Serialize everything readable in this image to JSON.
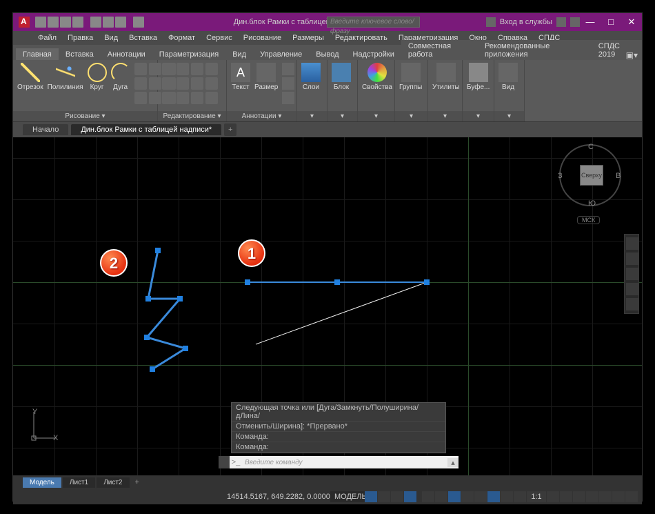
{
  "title": "Дин.блок Рамки с таблицей надписи...",
  "search_placeholder": "Введите ключевое слово/фразу",
  "login_label": "Вход в службы",
  "win": {
    "min": "—",
    "max": "□",
    "close": "✕"
  },
  "menu": [
    "Файл",
    "Правка",
    "Вид",
    "Вставка",
    "Формат",
    "Сервис",
    "Рисование",
    "Размеры",
    "Редактировать",
    "Параметризация",
    "Окно",
    "Справка",
    "СПДС"
  ],
  "tabs": [
    "Главная",
    "Вставка",
    "Аннотации",
    "Параметризация",
    "Вид",
    "Управление",
    "Вывод",
    "Надстройки",
    "Совместная работа",
    "Рекомендованные приложения",
    "СПДС 2019"
  ],
  "active_tab": 0,
  "ribbon": {
    "draw": {
      "title": "Рисование ▾",
      "items": [
        "Отрезок",
        "Полилиния",
        "Круг",
        "Дуга"
      ]
    },
    "edit": {
      "title": "Редактирование ▾"
    },
    "annot": {
      "title": "Аннотации ▾",
      "text": "Текст",
      "dim": "Размер"
    },
    "layers": "Слои",
    "block": "Блок",
    "props": "Свойства",
    "groups": "Группы",
    "utils": "Утилиты",
    "buffer": "Буфе...",
    "view": "Вид"
  },
  "file_tabs": {
    "start": "Начало",
    "doc": "Дин.блок Рамки с таблицей надписи*"
  },
  "viewcube": {
    "top": "Сверху",
    "n": "С",
    "s": "Ю",
    "e": "В",
    "w": "З",
    "wcs": "МСК"
  },
  "ucs": {
    "x": "X",
    "y": "Y"
  },
  "markers": {
    "one": "1",
    "two": "2"
  },
  "cmd_history": {
    "l1": "Следующая точка или [Дуга/Замкнуть/Полуширина/дЛина/",
    "l2": "Отменить/Ширина]: *Прервано*",
    "l3": "Команда:",
    "l4": "Команда:"
  },
  "cmd_prompt": ">_",
  "cmd_placeholder": "Введите команду",
  "layout_tabs": [
    "Модель",
    "Лист1",
    "Лист2"
  ],
  "status": {
    "coords": "14514.5167, 649.2282, 0.0000",
    "model": "МОДЕЛЬ",
    "scale": "1:1"
  }
}
